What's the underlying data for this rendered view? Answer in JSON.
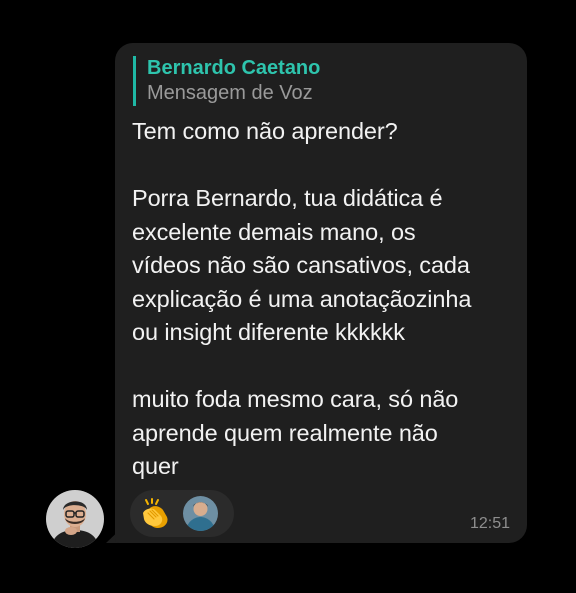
{
  "reply_quote": {
    "author": "Bernardo Caetano",
    "text": "Mensagem de Voz"
  },
  "message": {
    "paragraphs": [
      "Tem como não aprender?",
      "Porra Bernardo, tua didática é\nexcelente demais mano, os\nvídeos não são cansativos, cada\nexplicação é uma anotaçãozinha\nou insight diferente kkkkkk",
      "muito foda mesmo cara, só não\naprende quem realmente não\nquer"
    ],
    "timestamp": "12:51"
  },
  "reactions": {
    "emoji": "clapping-hands-icon",
    "reactor": "reactor-avatar"
  },
  "colors": {
    "background": "#000000",
    "bubble": "#1f1f1f",
    "quote_accent": "#1fb8a5",
    "quote_author": "#2ec4ad",
    "text": "#f2f2f2",
    "muted": "#8e8e8e"
  }
}
